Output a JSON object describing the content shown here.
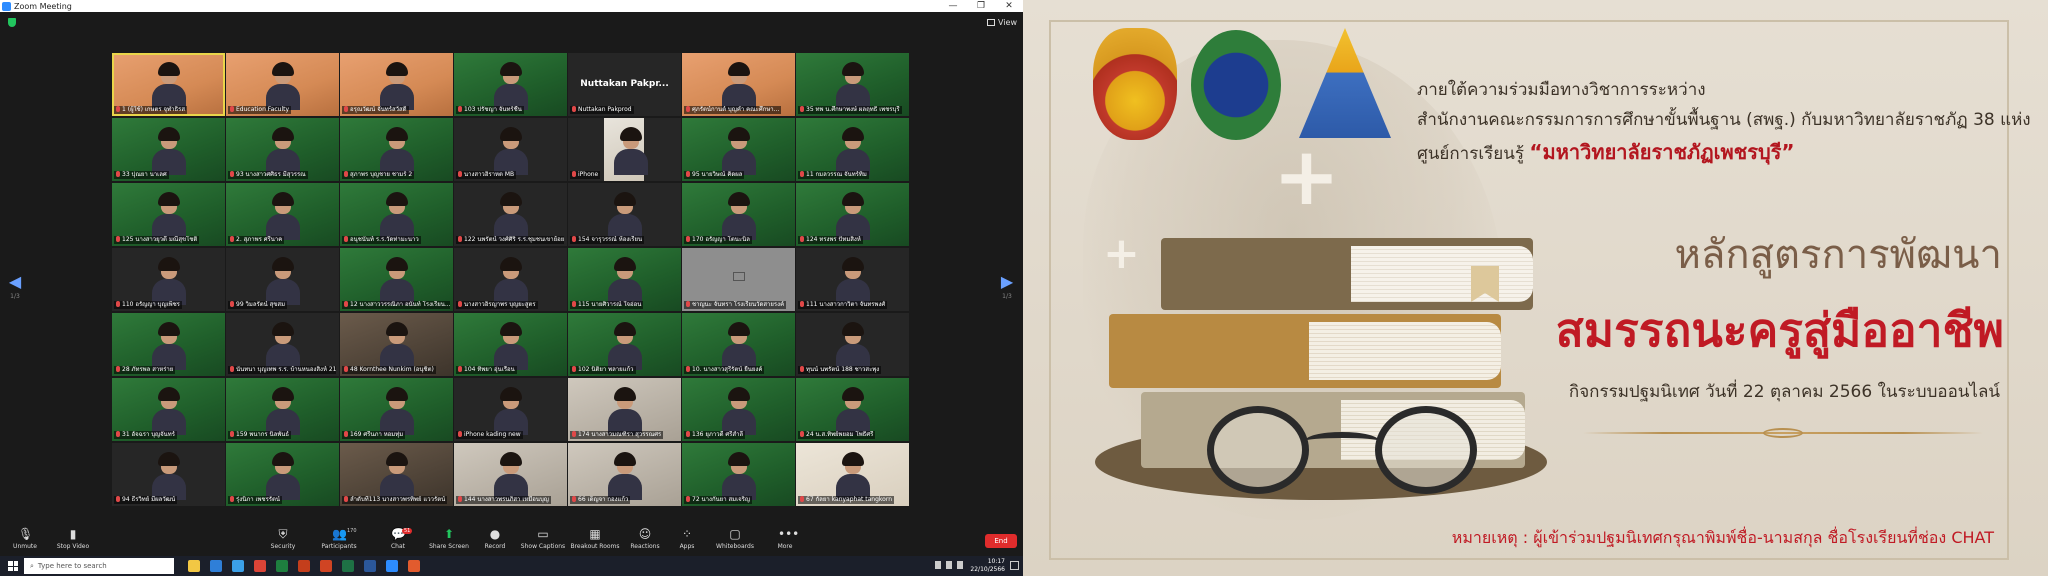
{
  "window": {
    "title": "Zoom Meeting",
    "view_label": "View"
  },
  "pager": {
    "left": "1/3",
    "right": "1/3"
  },
  "tiles": [
    {
      "name": "1 (ผู้ใช้) เกษตร จุฬาธิรส",
      "bg": "orange"
    },
    {
      "name": "Education Faculty",
      "bg": "orange"
    },
    {
      "name": "อรุณวัฒน์ จันทร์สวัสดิ์",
      "bg": "orange"
    },
    {
      "name": "103 ปรัชญา จันทร์ชื่น",
      "bg": "green"
    },
    {
      "name": "Nuttakan Pakprod",
      "bg": "dark",
      "big": "Nuttakan Pakpr..."
    },
    {
      "name": "ศุภรัตน์กานต์ บุญคำ คณะศึกษา...",
      "bg": "orange"
    },
    {
      "name": "35 ทพ น.ศึกษาพงษ์ ผลฤทธิ์ เพชรบุรี",
      "bg": "green"
    },
    {
      "name": "33 ปุณยา นาเลศ",
      "bg": "green"
    },
    {
      "name": "93 นางสาวศศิธร มีสุวรรณ",
      "bg": "green"
    },
    {
      "name": "สุภาพร บุญชาย ชามร์ 2",
      "bg": "green"
    },
    {
      "name": "นางสาวฮิราหต MB",
      "bg": "dark"
    },
    {
      "name": "iPhone",
      "bg": "phone"
    },
    {
      "name": "95 นายวิษณ์ คิดผล",
      "bg": "green"
    },
    {
      "name": "11 กมลวรรณ จันทร์ทิม",
      "bg": "green"
    },
    {
      "name": "125 นางสาวยุวดี มณีสุขโชติ",
      "bg": "green"
    },
    {
      "name": "2. สุภาพร ศรีนาค",
      "bg": "green"
    },
    {
      "name": "อนุชนันท์ ร.ร.วัดท่ามะนาว",
      "bg": "green"
    },
    {
      "name": "122 นพรัตน์ วงศ์ศิริ ร.ร.ชุมชนเขาย้อย",
      "bg": "dark"
    },
    {
      "name": "154 จารุวรรณ์ ห้องเรียน",
      "bg": "dark"
    },
    {
      "name": "170 อรัญญา โตนะนิล",
      "bg": "green"
    },
    {
      "name": "124 ทรงพร ปัทมสิงห์",
      "bg": "green"
    },
    {
      "name": "110 อรัญญา บุญเพ็ชร",
      "bg": "dark"
    },
    {
      "name": "99 วิมลรัตน์ สุขสม",
      "bg": "dark"
    },
    {
      "name": "12 นางสาววรรณิภา อนันท์ โรงเรียน...",
      "bg": "green"
    },
    {
      "name": "นางสาวอิรญาพร บุญยะสูตร",
      "bg": "dark"
    },
    {
      "name": "115 นายศิวารณ์ ใจอ่อน",
      "bg": "green"
    },
    {
      "name": "ชาญนะ จันทรา โรงเรียนวัดสายรงค์",
      "bg": "gray"
    },
    {
      "name": "111 นางสาวกาวิตา จันทรพงศ์",
      "bg": "dark"
    },
    {
      "name": "28 ภัทรพล สาหร่าย",
      "bg": "green"
    },
    {
      "name": "นันทนา บุญเทพ ร.ร. บ้านหนองสิงห์ 21",
      "bg": "dark"
    },
    {
      "name": "48 Kornthee Nunkim (อนุชิต)",
      "bg": "room"
    },
    {
      "name": "104 ทิพยา อุ่นเรือน",
      "bg": "green"
    },
    {
      "name": "102 นิติยา พลายแก้ว",
      "bg": "green"
    },
    {
      "name": "10. นางสาวสุรีรัตน์ ยืนยงค์",
      "bg": "green"
    },
    {
      "name": "ทุนน์ นพรัตน์ 188 ชาวสะพุง",
      "bg": "dark"
    },
    {
      "name": "31 อัจฉรา บุญจันทร์",
      "bg": "green"
    },
    {
      "name": "159 พนากร นิลพันธ์",
      "bg": "green"
    },
    {
      "name": "169 ศรีนภา หอมทุ่ม",
      "bg": "green"
    },
    {
      "name": "iPhone kading new",
      "bg": "dark"
    },
    {
      "name": "174 นางสาวมณฑิรา สุวรรณศร",
      "bg": "wall"
    },
    {
      "name": "136 ยุภาวดี ศรีสำลี",
      "bg": "green"
    },
    {
      "name": "24 น.ส.ทิพย์พยอม โพธิ์ศรี",
      "bg": "green"
    },
    {
      "name": "94 ธีรวิทย์ มีผลวัฒน์",
      "bg": "dark"
    },
    {
      "name": "รุ่งนิภา เพชรรัตน์",
      "bg": "green"
    },
    {
      "name": "ลำดับที่113 นางสาวพรทิพย์ แววรัตน์",
      "bg": "room"
    },
    {
      "name": "144 นางสาวพรนภิสา เหมือนบุญ",
      "bg": "wall"
    },
    {
      "name": "66 เด็ญจา กองแก้ว",
      "bg": "wall"
    },
    {
      "name": "72 นางกันยา สมเจริญ",
      "bg": "green"
    },
    {
      "name": "67 กัลยา kanyaphat tangkorn",
      "bg": "cream"
    }
  ],
  "toolbar": {
    "unmute": "Unmute",
    "stop_video": "Stop Video",
    "security": "Security",
    "participants": "Participants",
    "participants_count": "170",
    "chat": "Chat",
    "chat_badge": "51",
    "share_screen": "Share Screen",
    "record": "Record",
    "show_captions": "Show Captions",
    "breakout_rooms": "Breakout Rooms",
    "reactions": "Reactions",
    "apps": "Apps",
    "whiteboards": "Whiteboards",
    "more": "More",
    "end": "End"
  },
  "taskbar": {
    "search_placeholder": "Type here to search",
    "time": "10:17",
    "date": "22/10/2566"
  },
  "slide": {
    "line1": "ภายใต้ความร่วมมือทางวิชาการระหว่าง",
    "line2": "สำนักงานคณะกรรมการการศึกษาขั้นพื้นฐาน (สพฐ.) กับมหาวิทยาลัยราชภัฏ 38 แห่ง",
    "line3_prefix": "ศูนย์การเรียนรู้ ",
    "line3_highlight": "“มหาวิทยาลัยราชภัฏเพชรบุรี”",
    "course": "หลักสูตรการพัฒนา",
    "title": "สมรรถนะครูสู่มืออาชีพ",
    "date_line": "กิจกรรมปฐมนิเทศ วันที่ 22 ตุลาคม 2566 ในระบบออนไลน์",
    "note": "หมายเหตุ : ผู้เข้าร่วมปฐมนิเทศกรุณาพิมพ์ชื่อ-นามสกุล ชื่อโรงเรียนที่ช่อง CHAT"
  }
}
